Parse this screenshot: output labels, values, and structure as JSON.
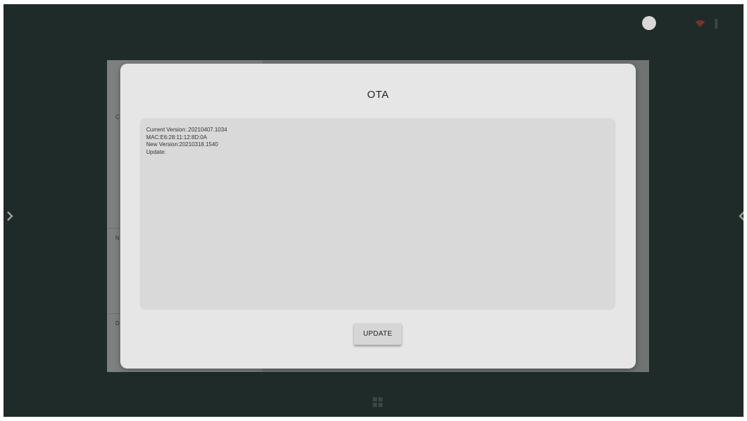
{
  "dialog": {
    "title": "OTA",
    "info": {
      "current_version": "Current Version:.20210407.1034",
      "mac": "MAC:E6:28:11:12:8D:0A",
      "new_version": "New Version:20210318.1540",
      "update": "Update:"
    },
    "update_button_label": "UPDATE"
  },
  "background": {
    "panel_chars": [
      "C",
      "N",
      "D"
    ]
  },
  "icons": {
    "status": "status-dot-icon",
    "wifi": "wifi-icon",
    "signal": "signal-icon",
    "left_nav": "chevron-right-icon",
    "right_nav": "chevron-left-icon",
    "start": "windows-icon"
  },
  "colors": {
    "desktop_bg": "#1f2b29",
    "dialog_bg": "#e6e6e6",
    "info_box_bg": "#d9d9d9",
    "button_bg": "#d6d6d6"
  }
}
